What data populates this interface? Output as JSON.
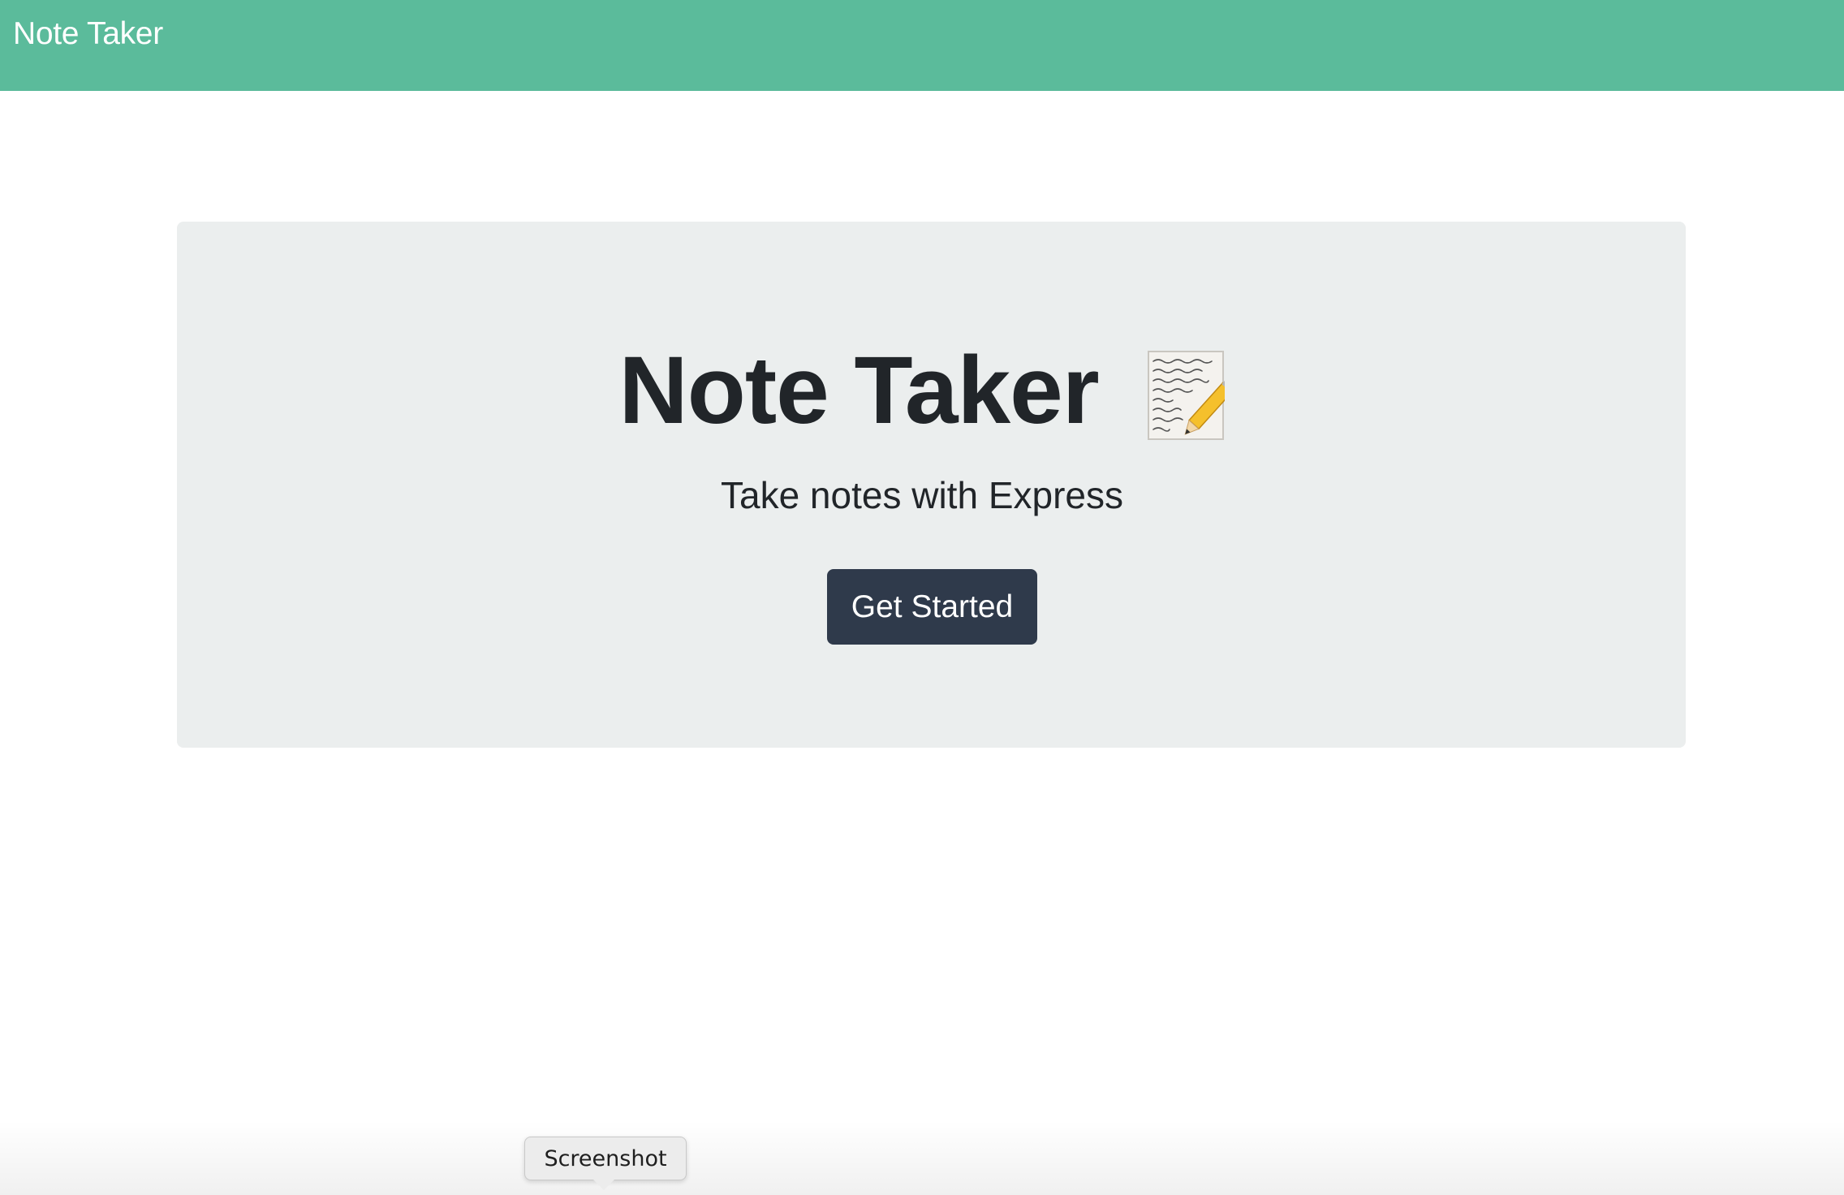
{
  "navbar": {
    "brand": "Note Taker",
    "background_color": "#5bbb9b"
  },
  "hero": {
    "title": "Note Taker",
    "icon": "memo-pencil-icon",
    "subtitle": "Take notes with Express",
    "button_label": "Get Started",
    "button_color": "#2f3a4b",
    "panel_color": "#ebeeee"
  },
  "tooltip": {
    "label": "Screenshot"
  }
}
